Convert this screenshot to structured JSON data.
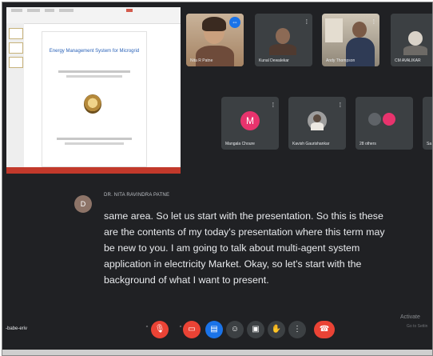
{
  "slide": {
    "title": "Energy Management System for Microgrid"
  },
  "participants": [
    {
      "name": "Nita R Patne",
      "pinned": true
    },
    {
      "name": "Kunal Dewalekar"
    },
    {
      "name": "Andy Thompson"
    },
    {
      "name": "CM AVALIKAR"
    },
    {
      "name": "Mangala Choure",
      "initial": "M"
    },
    {
      "name": "Kavish Gaurishankar"
    },
    {
      "name": "28 others"
    },
    {
      "name": "Sa"
    }
  ],
  "caption": {
    "avatar_initial": "D",
    "speaker": "DR. NITA RAVINDRA PATNE",
    "lines": [
      "same area. So let us start with the presentation. So this is these",
      "are the contents of my today's presentation where this term may",
      "be new to you. I am going to talk about multi-agent system",
      "application in electricity Market. Okay, so let's start with the",
      "background of what I want to present."
    ]
  },
  "bottom_bar": {
    "meeting_code": "-babe-eriv",
    "watermark_line1": "Activate",
    "watermark_line2": "Go to Settin"
  },
  "icons": {
    "mic": "mic-off-icon",
    "camera": "camera-off-icon",
    "captions": "captions-icon",
    "raise_hand": "raise-hand-icon",
    "present": "present-icon",
    "emoji": "emoji-icon",
    "more": "more-icon",
    "end_call": "end-call-icon"
  },
  "colors": {
    "background": "#202124",
    "tile": "#3c4043",
    "danger": "#ea4335",
    "accent": "#1a73e8",
    "avatar_pink": "#e8336d"
  }
}
